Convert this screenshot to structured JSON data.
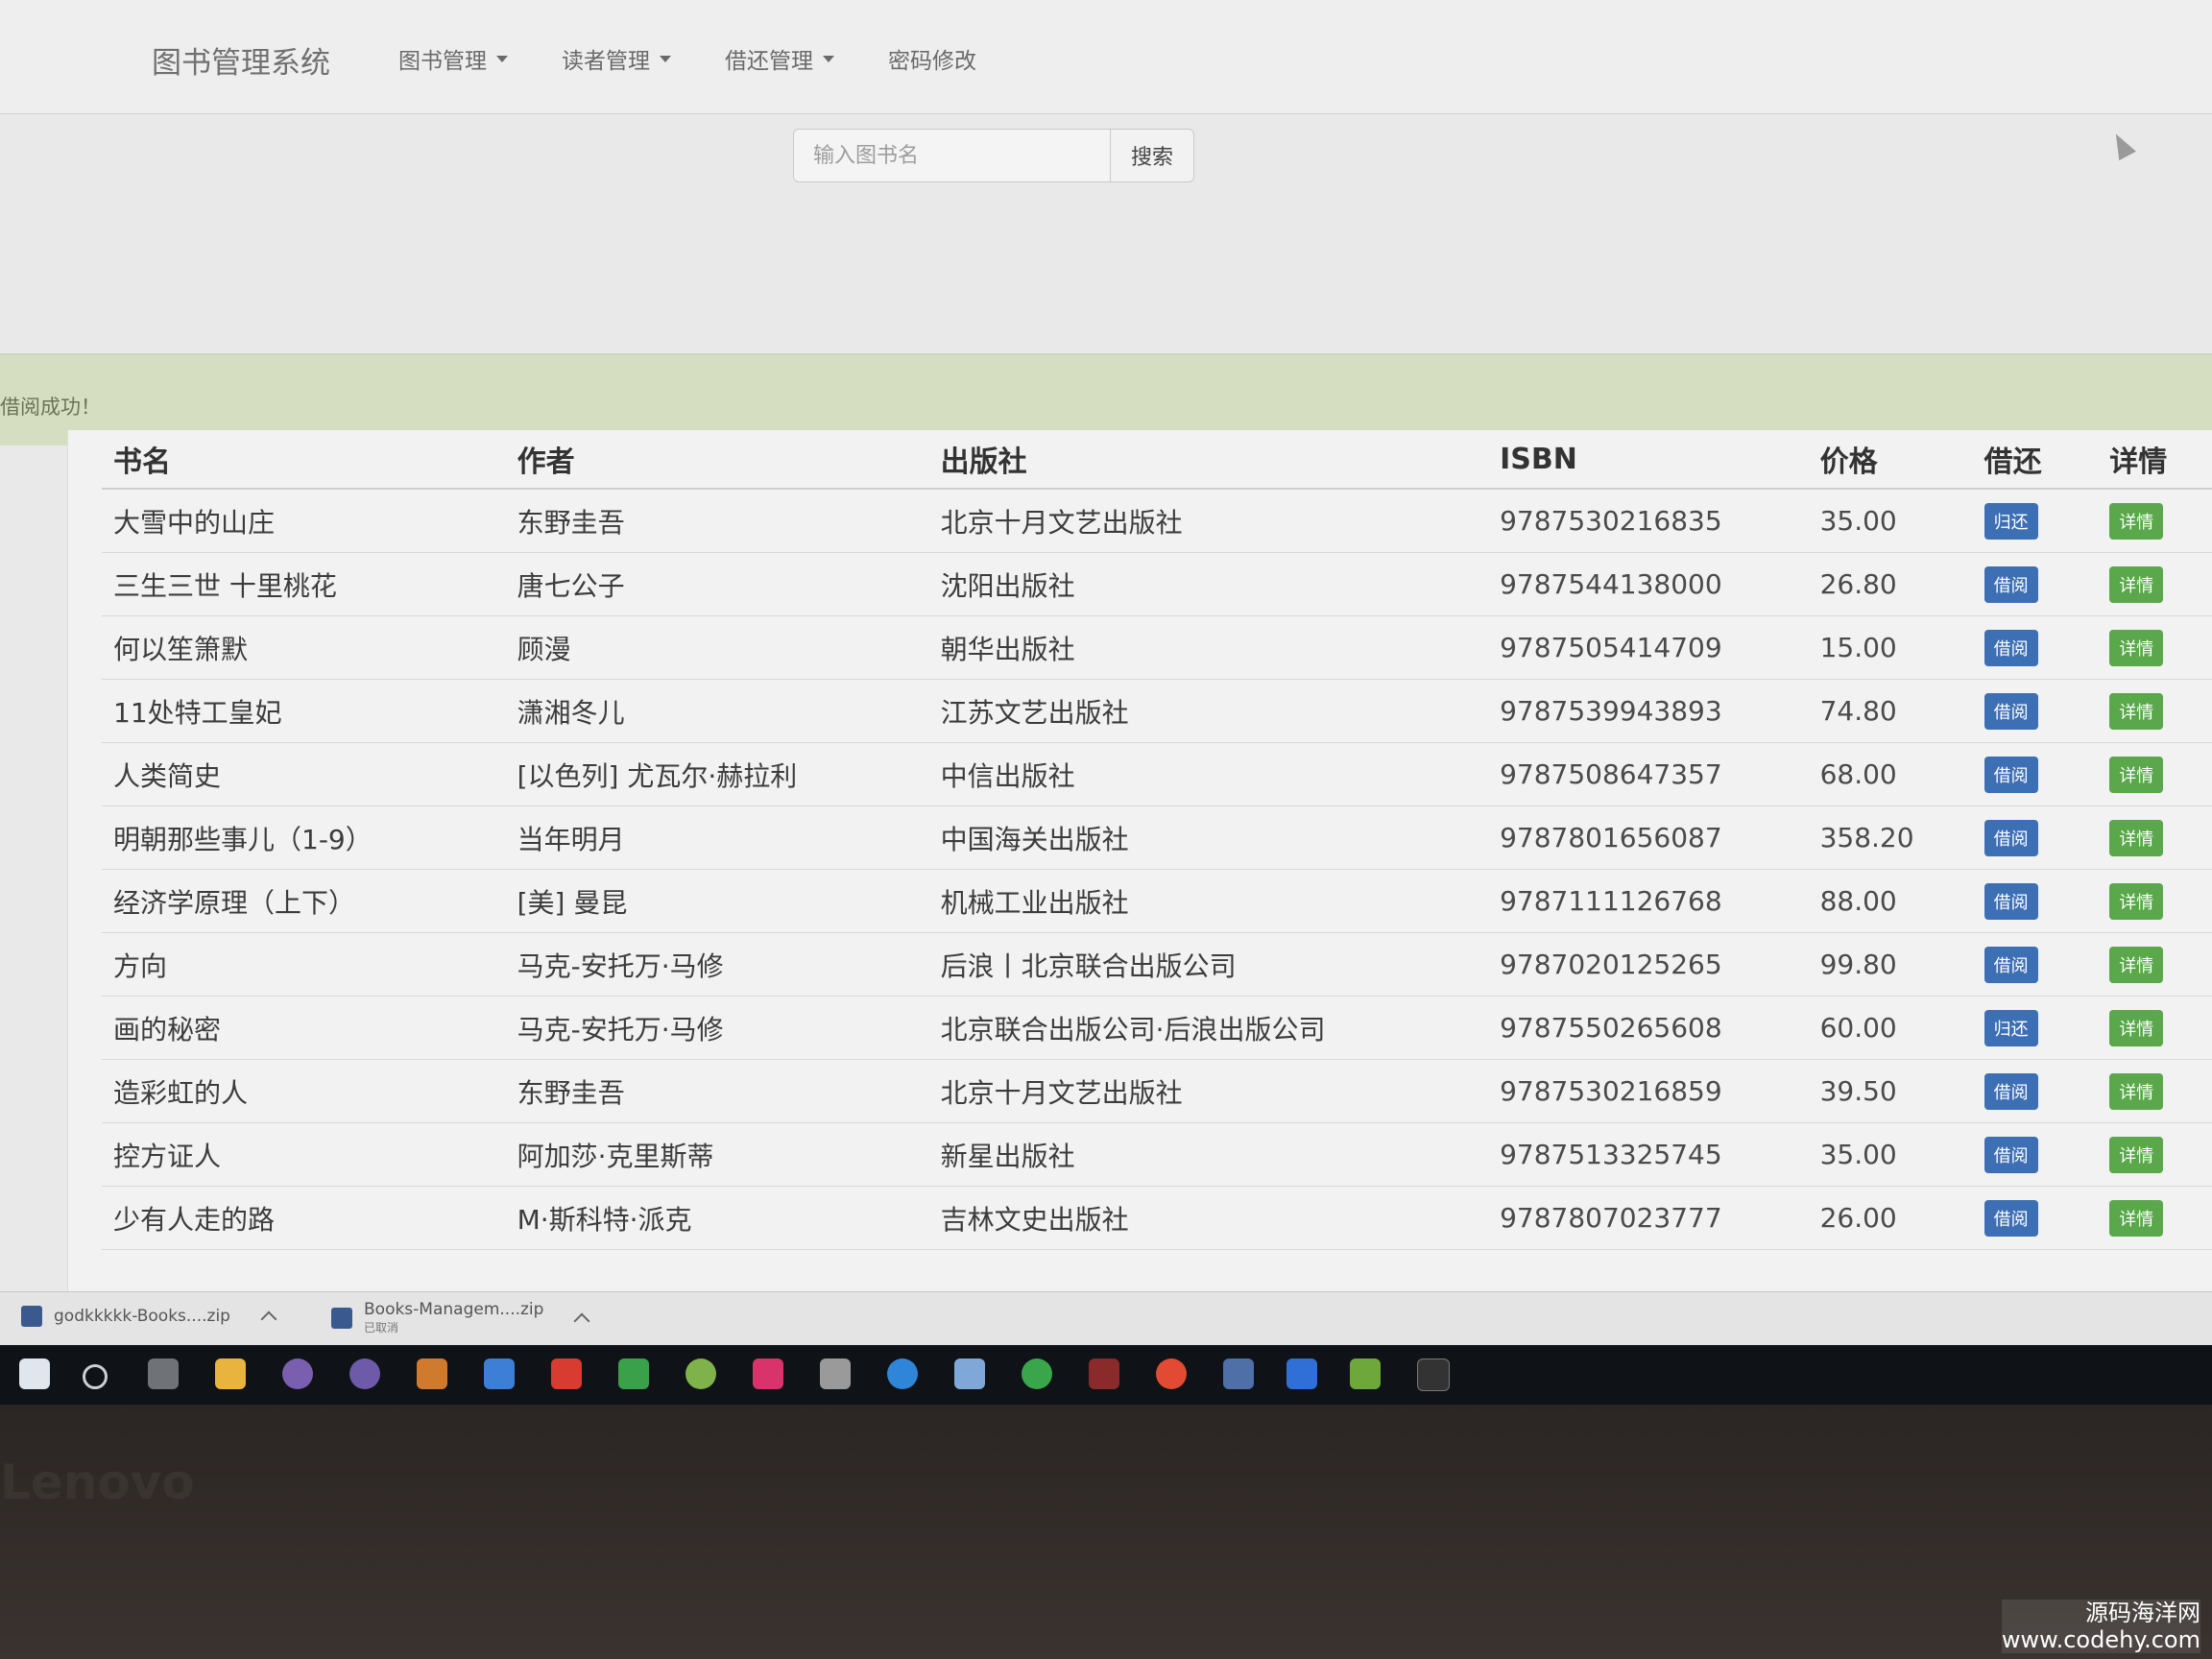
{
  "navbar": {
    "brand": "图书管理系统",
    "menus": [
      "图书管理",
      "读者管理",
      "借还管理"
    ],
    "link": "密码修改"
  },
  "search": {
    "placeholder": "输入图书名",
    "button": "搜索"
  },
  "alert": {
    "text": "借阅成功！"
  },
  "table": {
    "headers": [
      "书名",
      "作者",
      "出版社",
      "ISBN",
      "价格",
      "借还",
      "详情"
    ],
    "rows": [
      {
        "title": "大雪中的山庄",
        "author": "东野圭吾",
        "publisher": "北京十月文艺出版社",
        "isbn": "9787530216835",
        "price": "35.00",
        "action": "归还",
        "detail": "详情"
      },
      {
        "title": "三生三世 十里桃花",
        "author": "唐七公子",
        "publisher": "沈阳出版社",
        "isbn": "9787544138000",
        "price": "26.80",
        "action": "借阅",
        "detail": "详情"
      },
      {
        "title": "何以笙箫默",
        "author": "顾漫",
        "publisher": "朝华出版社",
        "isbn": "9787505414709",
        "price": "15.00",
        "action": "借阅",
        "detail": "详情"
      },
      {
        "title": "11处特工皇妃",
        "author": "潇湘冬儿",
        "publisher": "江苏文艺出版社",
        "isbn": "9787539943893",
        "price": "74.80",
        "action": "借阅",
        "detail": "详情"
      },
      {
        "title": "人类简史",
        "author": "[以色列] 尤瓦尔·赫拉利",
        "publisher": "中信出版社",
        "isbn": "9787508647357",
        "price": "68.00",
        "action": "借阅",
        "detail": "详情"
      },
      {
        "title": "明朝那些事儿（1-9）",
        "author": "当年明月",
        "publisher": "中国海关出版社",
        "isbn": "9787801656087",
        "price": "358.20",
        "action": "借阅",
        "detail": "详情"
      },
      {
        "title": "经济学原理（上下）",
        "author": "[美] 曼昆",
        "publisher": "机械工业出版社",
        "isbn": "9787111126768",
        "price": "88.00",
        "action": "借阅",
        "detail": "详情"
      },
      {
        "title": "方向",
        "author": "马克-安托万·马修",
        "publisher": "后浪丨北京联合出版公司",
        "isbn": "9787020125265",
        "price": "99.80",
        "action": "借阅",
        "detail": "详情"
      },
      {
        "title": "画的秘密",
        "author": "马克-安托万·马修",
        "publisher": "北京联合出版公司·后浪出版公司",
        "isbn": "9787550265608",
        "price": "60.00",
        "action": "归还",
        "detail": "详情"
      },
      {
        "title": "造彩虹的人",
        "author": "东野圭吾",
        "publisher": "北京十月文艺出版社",
        "isbn": "9787530216859",
        "price": "39.50",
        "action": "借阅",
        "detail": "详情"
      },
      {
        "title": "控方证人",
        "author": "阿加莎·克里斯蒂",
        "publisher": "新星出版社",
        "isbn": "9787513325745",
        "price": "35.00",
        "action": "借阅",
        "detail": "详情"
      },
      {
        "title": "少有人走的路",
        "author": "M·斯科特·派克",
        "publisher": "吉林文史出版社",
        "isbn": "9787807023777",
        "price": "26.00",
        "action": "借阅",
        "detail": "详情"
      }
    ]
  },
  "downloads": [
    {
      "name": "godkkkkk-Books....zip",
      "status": ""
    },
    {
      "name": "Books-Managem....zip",
      "status": "已取消"
    }
  ],
  "bezel_logo": "Lenovo",
  "watermark": {
    "line1": "源码海洋网",
    "line2": "www.codehy.com"
  },
  "colors": {
    "borrow_button": "#3c6fb3",
    "detail_button": "#5aa84b",
    "alert_bg": "#d6dec2"
  }
}
